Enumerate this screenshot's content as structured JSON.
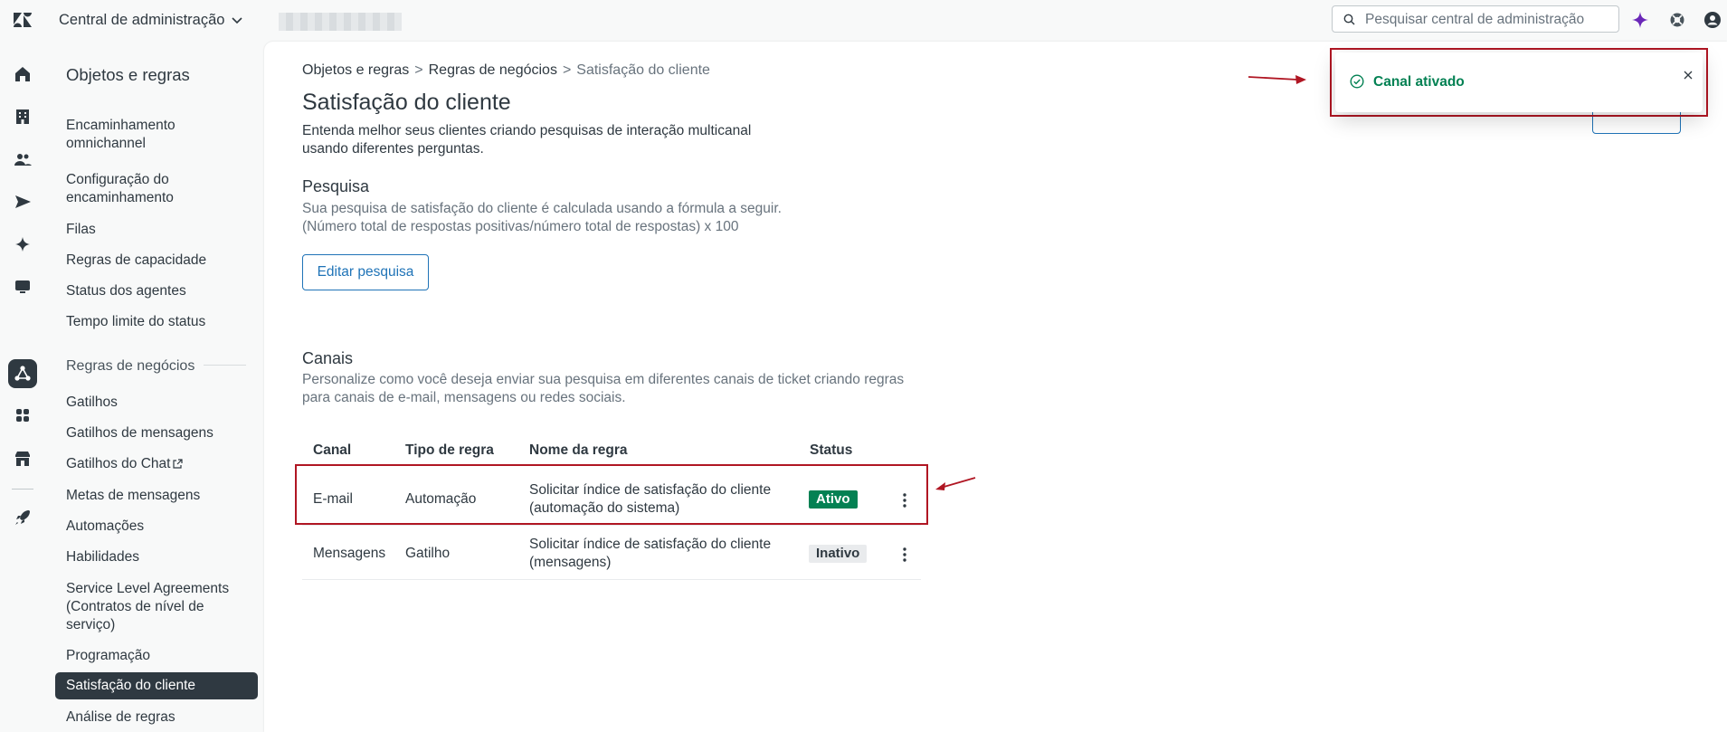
{
  "header": {
    "app_title": "Central de administração",
    "search_placeholder": "Pesquisar central de administração"
  },
  "sidebar": {
    "title": "Objetos e regras",
    "routing_items": [
      "Encaminhamento omnichannel",
      "Configuração do encaminhamento",
      "Filas",
      "Regras de capacidade",
      "Status dos agentes",
      "Tempo limite do status"
    ],
    "business_section": "Regras de negócios",
    "business_items": [
      "Gatilhos",
      "Gatilhos de mensagens",
      "Gatilhos do Chat",
      "Metas de mensagens",
      "Automações",
      "Habilidades",
      "Service Level Agreements (Contratos de nível de serviço)",
      "Programação",
      "Satisfação do cliente",
      "Análise de regras"
    ]
  },
  "breadcrumb": {
    "items": [
      "Objetos e regras",
      "Regras de negócios",
      "Satisfação do cliente"
    ],
    "separator": ">"
  },
  "page": {
    "title": "Satisfação do cliente",
    "description": "Entenda melhor seus clientes criando pesquisas de interação multicanal usando diferentes perguntas."
  },
  "survey": {
    "title": "Pesquisa",
    "line1": "Sua pesquisa de satisfação do cliente é calculada usando a fórmula a seguir.",
    "line2": "(Número total de respostas positivas/número total de respostas) x 100",
    "edit_button": "Editar pesquisa"
  },
  "channels": {
    "title": "Canais",
    "description": "Personalize como você deseja enviar sua pesquisa em diferentes canais de ticket criando regras para canais de e-mail, mensagens ou redes sociais.",
    "headers": [
      "Canal",
      "Tipo de regra",
      "Nome da regra",
      "Status"
    ],
    "rows": [
      {
        "channel": "E-mail",
        "type": "Automação",
        "name": "Solicitar índice de satisfação do cliente (automação do sistema)",
        "status": "Ativo"
      },
      {
        "channel": "Mensagens",
        "type": "Gatilho",
        "name": "Solicitar índice de satisfação do cliente (mensagens)",
        "status": "Inativo"
      }
    ]
  },
  "toast": {
    "message": "Canal ativado"
  },
  "colors": {
    "accent": "#1f73b7",
    "success": "#038153",
    "annotation": "#b01623",
    "sidebar_active": "#2f3941"
  },
  "icons": {
    "header": [
      "zendesk-logo-icon",
      "chevron-down-icon",
      "search-icon",
      "ai-sparkle-icon",
      "help-lifebuoy-icon",
      "user-avatar-icon"
    ],
    "rail": [
      "home-icon",
      "building-icon",
      "people-icon",
      "channels-send-icon",
      "ai-sparkle-icon",
      "workspaces-icon",
      "objects-rules-icon",
      "apps-icon",
      "account-icon",
      "rocket-icon"
    ]
  }
}
